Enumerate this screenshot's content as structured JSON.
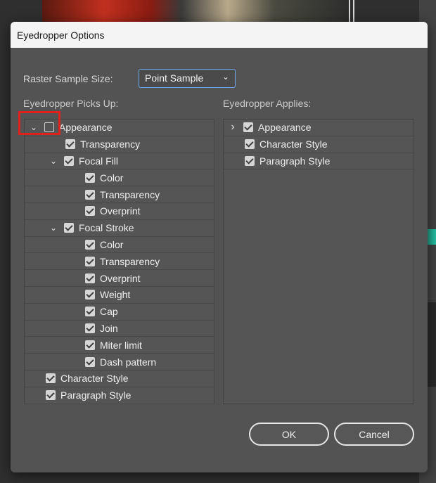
{
  "dialog": {
    "title": "Eyedropper Options",
    "raster_label": "Raster Sample Size:",
    "raster_value": "Point Sample",
    "picks_up_label": "Eyedropper Picks Up:",
    "applies_label": "Eyedropper Applies:",
    "ok_label": "OK",
    "cancel_label": "Cancel"
  },
  "picks_up": [
    {
      "label": "Appearance",
      "checked": false,
      "expanded": true
    },
    {
      "label": "Transparency",
      "checked": true
    },
    {
      "label": "Focal Fill",
      "checked": true,
      "expanded": true
    },
    {
      "label": "Color",
      "checked": true
    },
    {
      "label": "Transparency",
      "checked": true
    },
    {
      "label": "Overprint",
      "checked": true
    },
    {
      "label": "Focal Stroke",
      "checked": true,
      "expanded": true
    },
    {
      "label": "Color",
      "checked": true
    },
    {
      "label": "Transparency",
      "checked": true
    },
    {
      "label": "Overprint",
      "checked": true
    },
    {
      "label": "Weight",
      "checked": true
    },
    {
      "label": "Cap",
      "checked": true
    },
    {
      "label": "Join",
      "checked": true
    },
    {
      "label": "Miter limit",
      "checked": true
    },
    {
      "label": "Dash pattern",
      "checked": true
    },
    {
      "label": "Character Style",
      "checked": true
    },
    {
      "label": "Paragraph Style",
      "checked": true
    }
  ],
  "applies": [
    {
      "label": "Appearance",
      "checked": true,
      "expanded": false
    },
    {
      "label": "Character Style",
      "checked": true
    },
    {
      "label": "Paragraph Style",
      "checked": true
    }
  ],
  "icons": {
    "expanded": "chevron-down-icon",
    "collapsed": "chevron-right-icon",
    "checked": "checkmark-icon",
    "dropdown": "chevron-down-icon"
  },
  "colors": {
    "accent_focus": "#6fa7ee",
    "highlight": "#e0211b",
    "dialog_bg": "#535353"
  }
}
